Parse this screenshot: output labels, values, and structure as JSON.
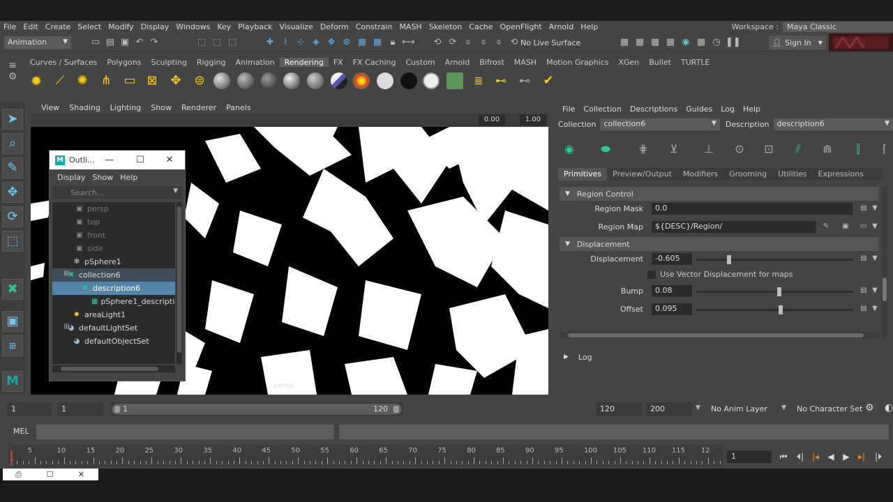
{
  "menubar": {
    "items": [
      "File",
      "Edit",
      "Create",
      "Select",
      "Modify",
      "Display",
      "Windows",
      "Key",
      "Playback",
      "Visualize",
      "Deform",
      "Constrain",
      "MASH",
      "Skeleton",
      "Cache",
      "OpenFlight",
      "Arnold",
      "Help"
    ],
    "workspace_label": "Workspace :",
    "workspace_value": "Maya Classic"
  },
  "statusline": {
    "mode": "Animation",
    "live_surface": "No Live Surface",
    "sign_in": "Sign In"
  },
  "shelf": {
    "tabs": [
      "Curves / Surfaces",
      "Polygons",
      "Sculpting",
      "Rigging",
      "Animation",
      "Rendering",
      "FX",
      "FX Caching",
      "Custom",
      "Arnold",
      "Bifrost",
      "MASH",
      "Motion Graphics",
      "XGen",
      "Bullet",
      "TURTLE"
    ],
    "active_tab": "Rendering"
  },
  "viewport": {
    "menu": [
      "View",
      "Shading",
      "Lighting",
      "Show",
      "Renderer",
      "Panels"
    ],
    "field_a": "0.00",
    "field_b": "1.00",
    "camera_label": "persp"
  },
  "outliner": {
    "title": "Outli...",
    "menu": [
      "Display",
      "Show",
      "Help"
    ],
    "search_placeholder": "Search...",
    "rows": [
      {
        "label": "persp",
        "icon": "camera-icon"
      },
      {
        "label": "top",
        "icon": "camera-icon"
      },
      {
        "label": "front",
        "icon": "camera-icon"
      },
      {
        "label": "side",
        "icon": "camera-icon"
      },
      {
        "label": "pSphere1",
        "icon": "mesh-icon"
      },
      {
        "label": "collection6",
        "icon": "xgen-collection-icon"
      },
      {
        "label": "description6",
        "icon": "xgen-description-icon"
      },
      {
        "label": "pSphere1_description",
        "icon": "patch-icon"
      },
      {
        "label": "areaLight1",
        "icon": "light-icon"
      },
      {
        "label": "defaultLightSet",
        "icon": "set-icon"
      },
      {
        "label": "defaultObjectSet",
        "icon": "set-icon"
      }
    ]
  },
  "xgen": {
    "menu": [
      "File",
      "Collection",
      "Descriptions",
      "Guides",
      "Log",
      "Help"
    ],
    "collection_label": "Collection",
    "collection_value": "collection6",
    "description_label": "Description",
    "description_value": "description6",
    "tabs": [
      "Primitives",
      "Preview/Output",
      "Modifiers",
      "Grooming",
      "Utilities",
      "Expressions"
    ],
    "active_tab": "Primitives",
    "region_control": {
      "title": "Region Control",
      "mask_label": "Region Mask",
      "mask_value": "0.0",
      "map_label": "Region Map",
      "map_value": "${DESC}/Region/"
    },
    "displacement": {
      "title": "Displacement",
      "disp_label": "Displacement",
      "disp_value": "-0.605",
      "disp_fraction": 0.2,
      "vector_label": "Use Vector Displacement for maps",
      "bump_label": "Bump",
      "bump_value": "0.08",
      "bump_fraction": 0.53,
      "offset_label": "Offset",
      "offset_value": "0.095",
      "offset_fraction": 0.54
    },
    "log_label": "Log"
  },
  "range": {
    "start": "1",
    "playback_start": "1",
    "slider_start": "1",
    "slider_end": "120",
    "playback_end": "120",
    "end": "200",
    "anim_layer": "No Anim Layer",
    "char_set": "No Character Set"
  },
  "mel": {
    "label": "MEL"
  },
  "timeline": {
    "labels": [
      "1",
      "5",
      "10",
      "15",
      "20",
      "25",
      "30",
      "35",
      "40",
      "45",
      "50",
      "55",
      "60",
      "65",
      "70",
      "75",
      "80",
      "85",
      "90",
      "95",
      "100",
      "105",
      "110",
      "115",
      "12"
    ],
    "current_frame": "1"
  }
}
